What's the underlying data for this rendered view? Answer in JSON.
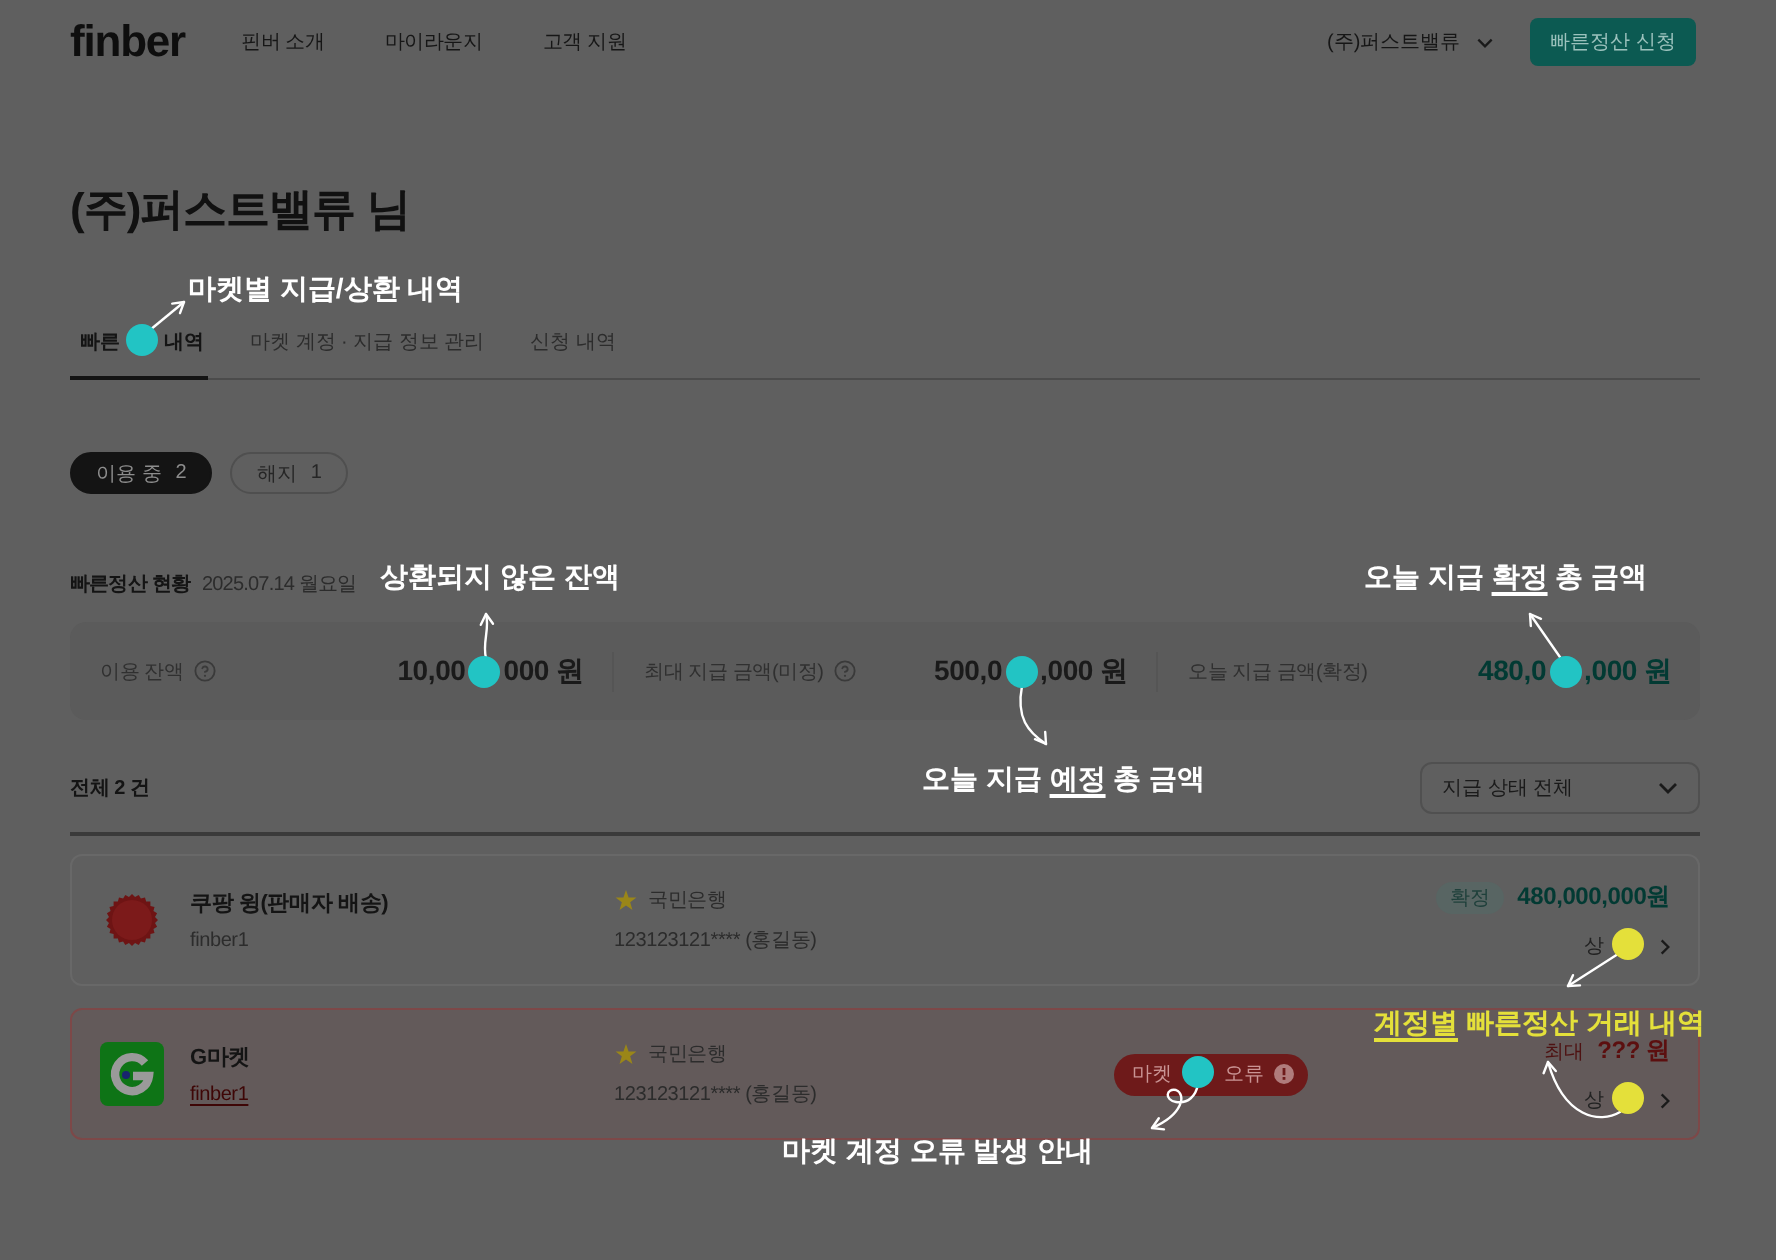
{
  "header": {
    "logo": "finber",
    "nav": [
      "핀버 소개",
      "마이라운지",
      "고객 지원"
    ],
    "account": "(주)퍼스트밸류",
    "cta": "빠른정산 신청"
  },
  "page_title": "(주)퍼스트밸류 님",
  "tabs": [
    {
      "label": [
        "빠른",
        "내역"
      ],
      "selected": true
    },
    {
      "label": "마켓 계정 · 지급 정보 관리",
      "selected": false
    },
    {
      "label": "신청 내역",
      "selected": false
    }
  ],
  "filters": [
    {
      "label": "이용 중",
      "count": "2",
      "selected": true
    },
    {
      "label": "해지",
      "count": "1",
      "selected": false
    }
  ],
  "summary": {
    "title": "빠른정산 현황",
    "date": "2025.07.14 월요일",
    "stats": [
      {
        "kind": "plain",
        "label": "이용 잔액",
        "help": true,
        "value": [
          "10,00",
          "000 원"
        ]
      },
      {
        "kind": "plain",
        "label": "최대 지급 금액(미정)",
        "help": true,
        "value": [
          "500,0",
          ",000 원"
        ]
      },
      {
        "kind": "confirmed",
        "label": "오늘 지급 금액(확정)",
        "help": false,
        "value": [
          "480,0",
          ",000 원"
        ]
      }
    ]
  },
  "list": {
    "total": "전체 2 건",
    "filter": "지급 상태 전체",
    "rows": [
      {
        "kind": "confirmed",
        "market": "쿠팡 윙(판매자 배송)",
        "account": "finber1",
        "bank": "국민은행",
        "bank_account": "123123121**** (홍길동)",
        "status": "확정",
        "amount": "480,000,000원",
        "detail": [
          "상"
        ]
      },
      {
        "kind": "error",
        "market": "G마켓",
        "account": "finber1",
        "bank": "국민은행",
        "bank_account": "123123121**** (홍길동)",
        "error": [
          "마켓",
          "오류"
        ],
        "amount_prefix": "최대",
        "amount": "??? 원",
        "detail": [
          "상"
        ]
      }
    ]
  },
  "annotations": [
    {
      "color": "#22c4c4",
      "highlight": false,
      "label": [
        {
          "text": "마켓별 지급/상환 내역",
          "underline": false
        }
      ]
    },
    {
      "color": "#22c4c4",
      "highlight": false,
      "label": [
        {
          "text": "상환되지 않은 잔액",
          "underline": false
        }
      ]
    },
    {
      "color": "#22c4c4",
      "highlight": false,
      "label": [
        {
          "text": "오늘 지급 ",
          "underline": false
        },
        {
          "text": "예정",
          "underline": true
        },
        {
          "text": " 총 금액",
          "underline": false
        }
      ]
    },
    {
      "color": "#22c4c4",
      "highlight": false,
      "label": [
        {
          "text": "오늘 지급 ",
          "underline": false
        },
        {
          "text": "확정",
          "underline": true
        },
        {
          "text": " 총 금액",
          "underline": false
        }
      ]
    },
    {
      "color": "#e4e03a",
      "highlight": true,
      "label": [
        {
          "text": "계정별",
          "underline": true
        },
        {
          "text": " 빠른정산 거래 내역",
          "underline": false
        }
      ]
    },
    {
      "color": "#22c4c4",
      "highlight": false,
      "label": [
        {
          "text": "마켓 계정 오류 발생 안내",
          "underline": false
        }
      ]
    }
  ]
}
